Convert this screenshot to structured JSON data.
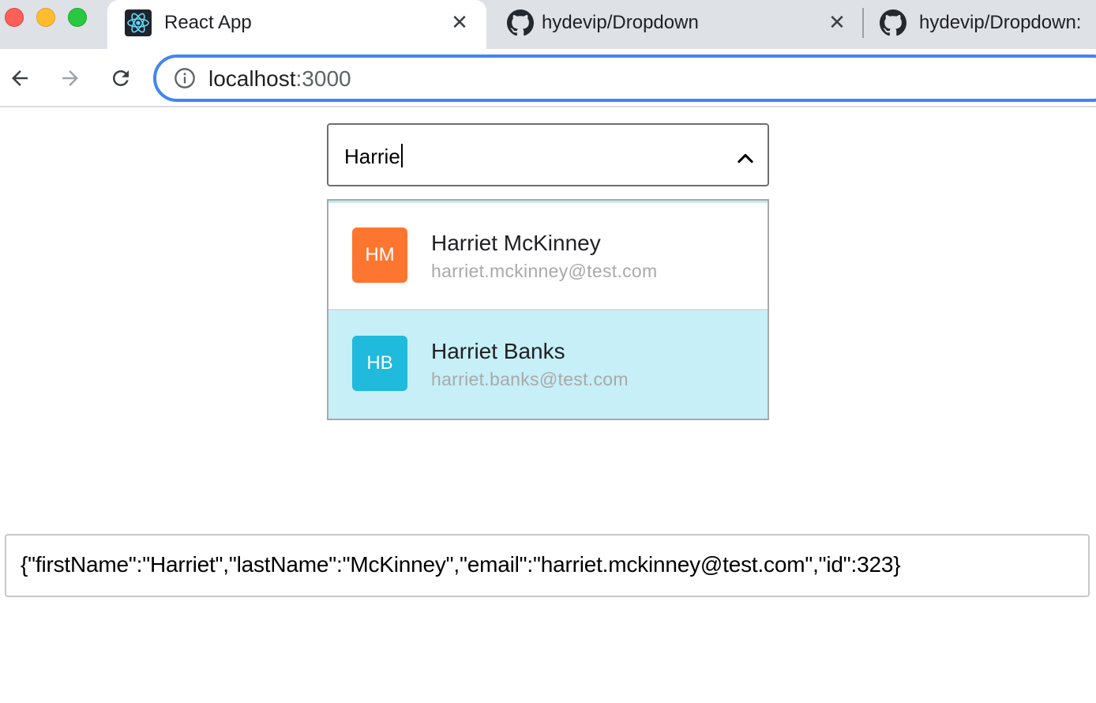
{
  "browser": {
    "tabs": [
      {
        "title": "React App",
        "icon": "react-icon",
        "active": true
      },
      {
        "title": "hydevip/Dropdown",
        "icon": "github-icon",
        "active": false
      },
      {
        "title": "hydevip/Dropdown:",
        "icon": "github-icon",
        "active": false
      }
    ],
    "close_glyph": "✕",
    "url_host": "localhost",
    "url_port": ":3000"
  },
  "dropdown": {
    "input_value": "Harrie",
    "expanded": true,
    "options": [
      {
        "initials": "HM",
        "name": "Harriet McKinney",
        "email": "harriet.mckinney@test.com",
        "avatar_color": "#fd7630",
        "highlighted": false
      },
      {
        "initials": "HB",
        "name": "Harriet Banks",
        "email": "harriet.banks@test.com",
        "avatar_color": "#1fbadc",
        "highlighted": true
      }
    ]
  },
  "output": {
    "json_text": "{\"firstName\":\"Harriet\",\"lastName\":\"McKinney\",\"email\":\"harriet.mckinney@test.com\",\"id\":323}"
  },
  "colors": {
    "omnibox_focus": "#4285f4",
    "highlight_row": "#c6eff7"
  }
}
